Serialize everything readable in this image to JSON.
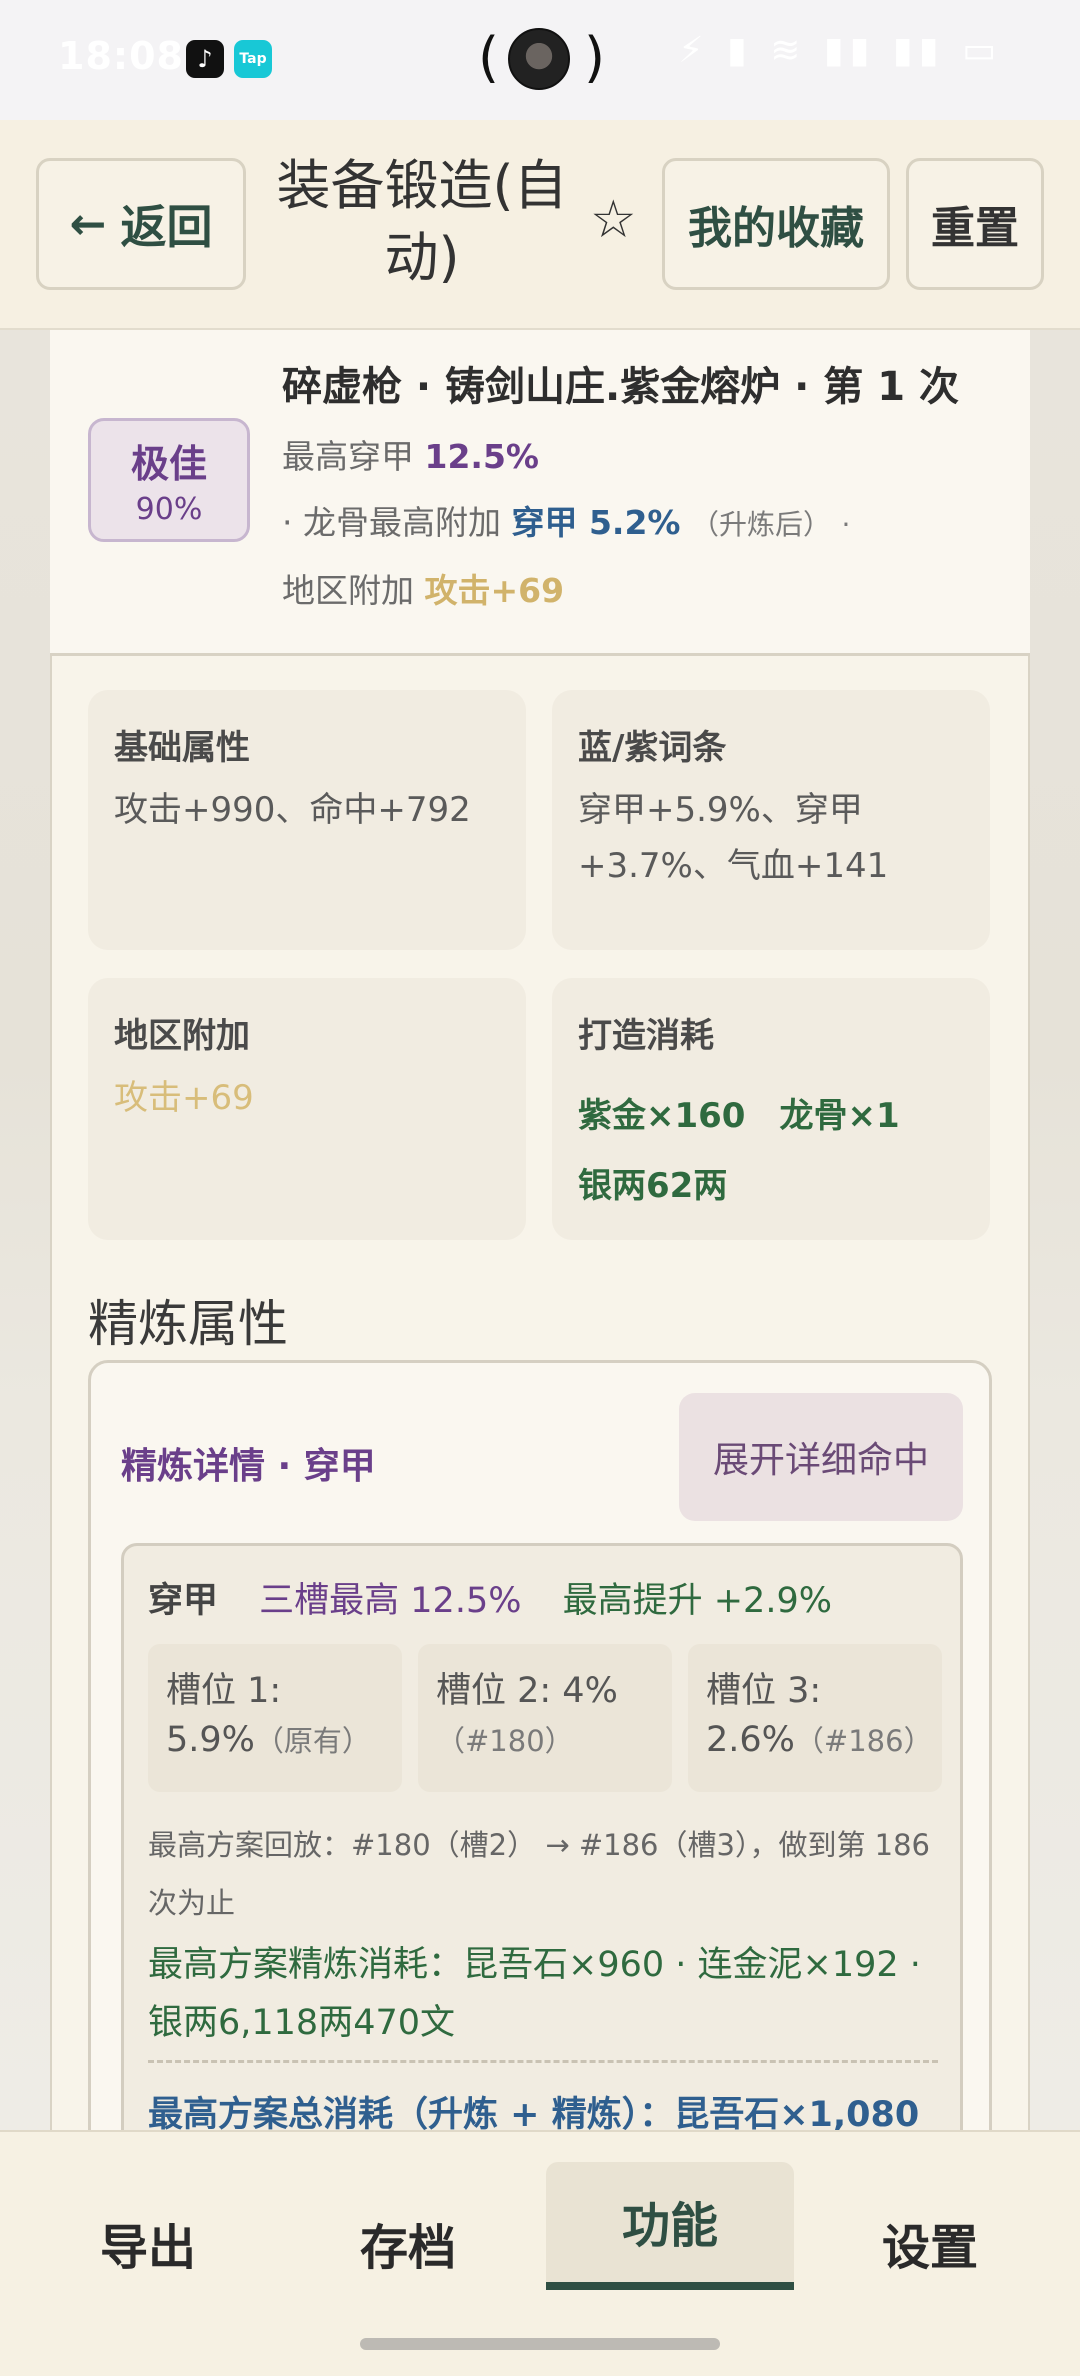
{
  "status_bar": {
    "time": "18:08",
    "app1_icon": "tiktok-icon",
    "app2_label": "Tap",
    "paren_left": "(",
    "paren_right": ")",
    "right_icons": "⚡ ▮ ≋ ▮▮ ▮▮ ▭"
  },
  "header": {
    "back_arrow": "←",
    "back_label": "返回",
    "title": "装备锻造(自动)",
    "star": "☆",
    "favorites_label": "我的收藏",
    "reset_label": "重置"
  },
  "result": {
    "title": "碎虚枪 · 铸剑山庄.紫金熔炉 · 第 1 次",
    "grade_label": "极佳",
    "grade_pct": "90%",
    "max_armor_prefix": "最高穿甲",
    "max_armor_value": "12.5%",
    "dragon_prefix": "· 龙骨最高附加",
    "dragon_value": "穿甲 5.2%",
    "dragon_note": "（升炼后）",
    "dragon_suffix": "·",
    "region_prefix": "地区附加",
    "region_value": "攻击+69"
  },
  "base_attr": {
    "title": "基础属性",
    "body": "攻击+990、命中+792"
  },
  "blue_purple": {
    "title": "蓝/紫词条",
    "body": "穿甲+5.9%、穿甲+3.7%、气血+141"
  },
  "region_bonus": {
    "title": "地区附加",
    "body": "攻击+69"
  },
  "forge_cost": {
    "title": "打造消耗",
    "line1": "紫金×160　龙骨×1",
    "line2": "银两62两"
  },
  "refine": {
    "section_title": "精炼属性",
    "head": "精炼详情 · 穿甲",
    "expand_label": "展开详细命中",
    "summary_label": "穿甲",
    "summary_max": "三槽最高 12.5%",
    "summary_gain": "最高提升 +2.9%",
    "slots": [
      {
        "label": "槽位 1:",
        "value": "5.9%",
        "note": "（原有）"
      },
      {
        "label": "槽位 2:  4%",
        "value": "",
        "note": "（#180）"
      },
      {
        "label": "槽位 3:",
        "value": "2.6%",
        "note": "（#186）"
      }
    ],
    "replay": "最高方案回放：#180（槽2） → #186（槽3），做到第 186 次为止",
    "refine_cost": "最高方案精炼消耗：昆吾石×960 · 连金泥×192 · 银两6,118两470文",
    "total_cost": "最高方案总消耗（升炼 + 精炼）：昆吾石×1,080"
  },
  "nav": {
    "export": "导出",
    "save": "存档",
    "function": "功能",
    "settings": "设置"
  }
}
